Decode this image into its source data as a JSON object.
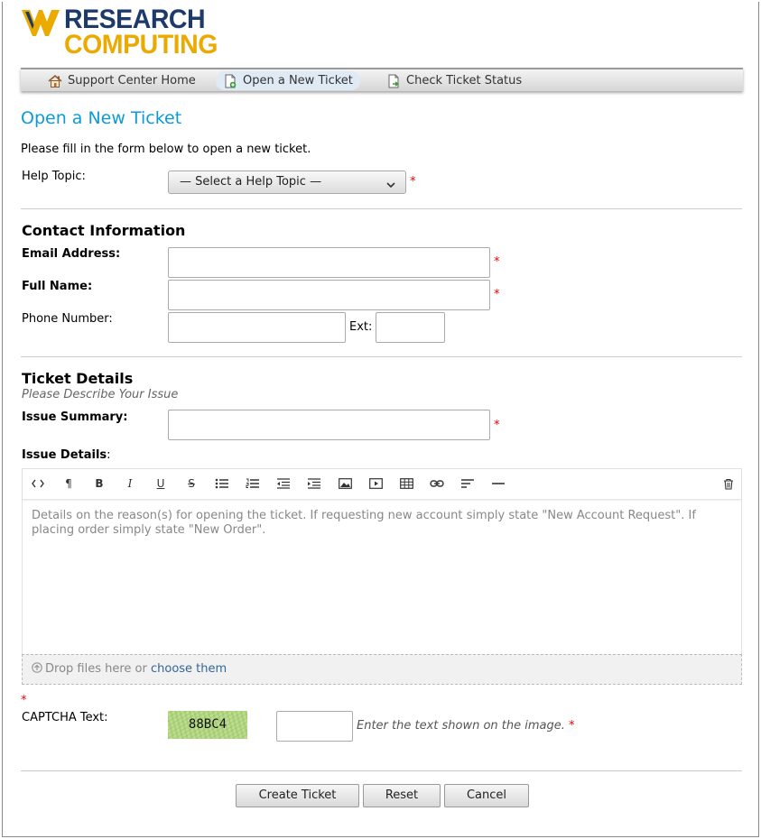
{
  "brand": {
    "line1": "RESEARCH",
    "line2": "COMPUTING",
    "colors": {
      "navy": "#1d3a6b",
      "gold": "#eaaa00"
    }
  },
  "nav": {
    "items": [
      {
        "label": "Support Center Home",
        "icon": "home-icon"
      },
      {
        "label": "Open a New Ticket",
        "icon": "new-ticket-icon",
        "active": true
      },
      {
        "label": "Check Ticket Status",
        "icon": "ticket-status-icon"
      }
    ]
  },
  "page": {
    "title": "Open a New Ticket",
    "intro": "Please fill in the form below to open a new ticket.",
    "accent": "#0c9ad8"
  },
  "help_topic": {
    "label": "Help Topic:",
    "selected": "— Select a Help Topic —",
    "required_mark": "*"
  },
  "contact": {
    "heading": "Contact Information",
    "email_label": "Email Address:",
    "name_label": "Full Name:",
    "phone_label": "Phone Number:",
    "ext_label": "Ext:",
    "email_value": "",
    "name_value": "",
    "phone_value": "",
    "ext_value": ""
  },
  "ticket": {
    "heading": "Ticket Details",
    "subheading": "Please Describe Your Issue",
    "summary_label": "Issue Summary:",
    "summary_value": "",
    "details_label": "Issue Details",
    "details_colon": ":",
    "details_placeholder": "Details on the reason(s) for opening the ticket. If requesting new account simply state \"New Account Request\". If placing order simply state \"New Order\".",
    "toolbar": [
      "code-view-icon",
      "paragraph-icon",
      "bold-icon",
      "italic-icon",
      "underline-icon",
      "strikethrough-icon",
      "bullet-list-icon",
      "numbered-list-icon",
      "outdent-icon",
      "indent-icon",
      "image-icon",
      "video-icon",
      "table-icon",
      "link-icon",
      "align-icon",
      "horizontal-rule-icon",
      "trash-icon"
    ],
    "toolbar_glyphs": {
      "paragraph": "¶",
      "bold": "B",
      "italic": "I",
      "underline": "U",
      "strikethrough": "S"
    }
  },
  "attachments": {
    "prefix": "Drop files here or",
    "link": "choose them"
  },
  "captcha": {
    "label": "CAPTCHA Text:",
    "image_text": "88BC4",
    "hint": "Enter the text shown on the image.",
    "value": ""
  },
  "buttons": {
    "create": "Create Ticket",
    "reset": "Reset",
    "cancel": "Cancel"
  }
}
